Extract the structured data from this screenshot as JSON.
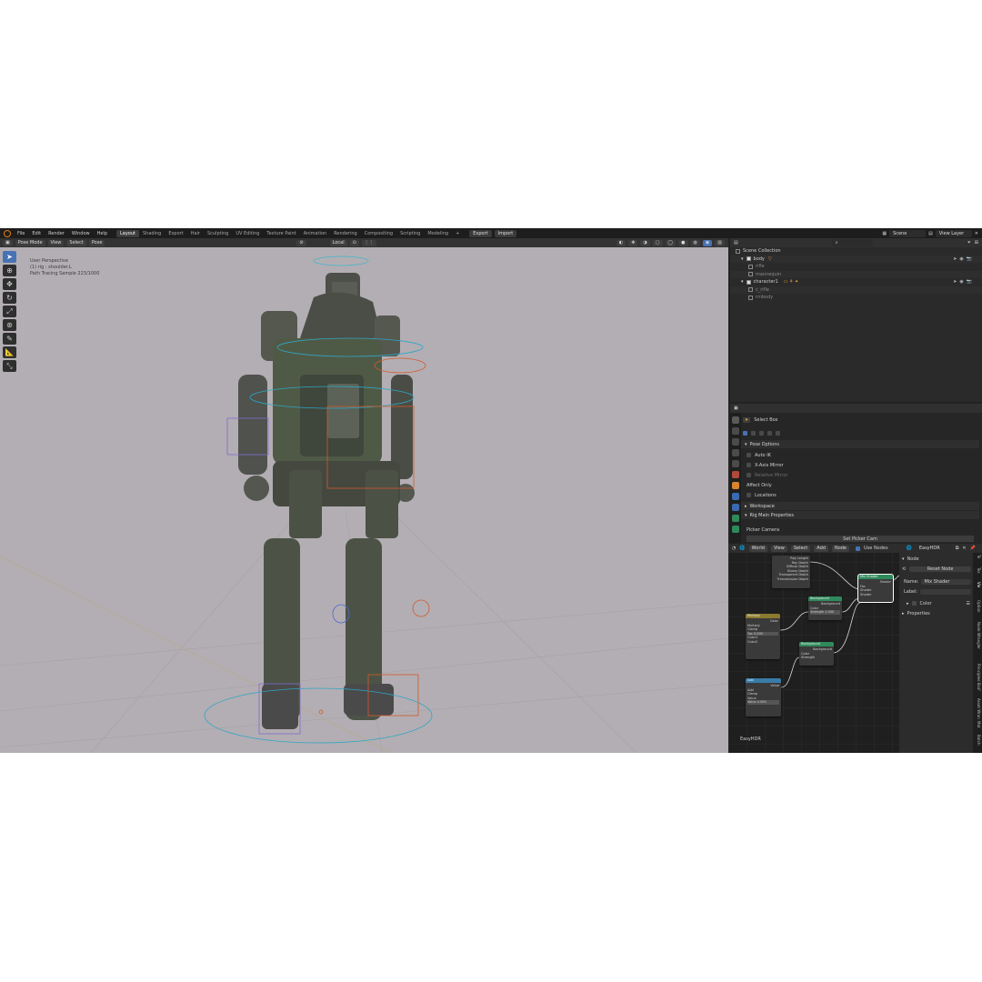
{
  "topbar": {
    "menus": [
      "File",
      "Edit",
      "Render",
      "Window",
      "Help"
    ],
    "workspaces": [
      "Layout",
      "Shading",
      "Export",
      "Hair",
      "Sculpting",
      "UV Editing",
      "Texture Paint",
      "Animation",
      "Rendering",
      "Compositing",
      "Scripting",
      "Modeling"
    ],
    "active_workspace": "Layout",
    "export_label": "Export",
    "import_label": "Import",
    "scene": "Scene",
    "view_layer": "View Layer"
  },
  "viewport": {
    "mode": "Pose Mode",
    "menus": [
      "View",
      "Select",
      "Pose"
    ],
    "orientation": "Local",
    "info": [
      "User Perspective",
      "(1) rig : shoulder.L",
      "Path Tracing Sample 223/1000"
    ],
    "background": "#b3aeb3"
  },
  "outliner": {
    "collection": "Scene Collection",
    "rows": [
      {
        "label": "body",
        "indent": 1
      },
      {
        "label": "rifle",
        "indent": 2
      },
      {
        "label": "mannequin",
        "indent": 2
      },
      {
        "label": "character1",
        "indent": 1
      },
      {
        "label": "c_rifle",
        "indent": 2
      },
      {
        "label": "rmbody",
        "indent": 2
      }
    ]
  },
  "properties": {
    "tool": "Select Box",
    "pose_options": "Pose Options",
    "auto_ik": "Auto IK",
    "x_axis_mirror": "X-Axis Mirror",
    "relative_mirror": "Relative Mirror",
    "affect_only": "Affect Only",
    "locations": "Locations",
    "workspace": "Workspace",
    "rig_main": "Rig Main Properties",
    "picker_camera": "Picker Camera",
    "set_picker": "Set Picker Cam"
  },
  "node_editor": {
    "world": "World",
    "menus": [
      "View",
      "Select",
      "Add",
      "Node"
    ],
    "use_nodes": "Use Nodes",
    "name_field": "EasyHDR",
    "footer_label": "EasyHDR",
    "side": {
      "node_section": "Node",
      "reset_node": "Reset Node",
      "name_label": "Name:",
      "name_value": "Mix Shader",
      "label_label": "Label:",
      "color": "Color",
      "properties": "Properties"
    },
    "vtabs": [
      "Te",
      "Tex",
      "Vie",
      "Option",
      "Node Wrangler",
      "Principled Bsdf",
      "Asset Wran",
      "Mat",
      "Batch"
    ],
    "nodes": {
      "light_path": [
        "Ray Length",
        "Ray Depth",
        "Diffuse Depth",
        "Glossy Depth",
        "Transparent Depth",
        "Transmission Depth"
      ],
      "mix": {
        "title": "Mix Shader",
        "rows": [
          "Shader",
          "Fac",
          "Shader",
          "Shader"
        ]
      },
      "bg1": {
        "title": "Background",
        "rows": [
          "Background",
          "Color",
          "Strength 1.000"
        ]
      },
      "mixrgb": {
        "title": "Multiply",
        "rows": [
          "Color",
          "Multiply",
          "Clamp",
          "Fac 0.000",
          "Color1",
          "Color2"
        ]
      },
      "bg2": {
        "title": "Background",
        "rows": [
          "Background",
          "Color",
          "Strength"
        ]
      },
      "math": {
        "title": "Add",
        "rows": [
          "Value",
          "Add",
          "Clamp",
          "Value",
          "Value 0.000"
        ]
      }
    }
  },
  "colors": {
    "accent": "#4772b3",
    "shader_node": "#2f8a5b",
    "color_node": "#8a7a2f",
    "converter_node": "#3a7ca8"
  }
}
